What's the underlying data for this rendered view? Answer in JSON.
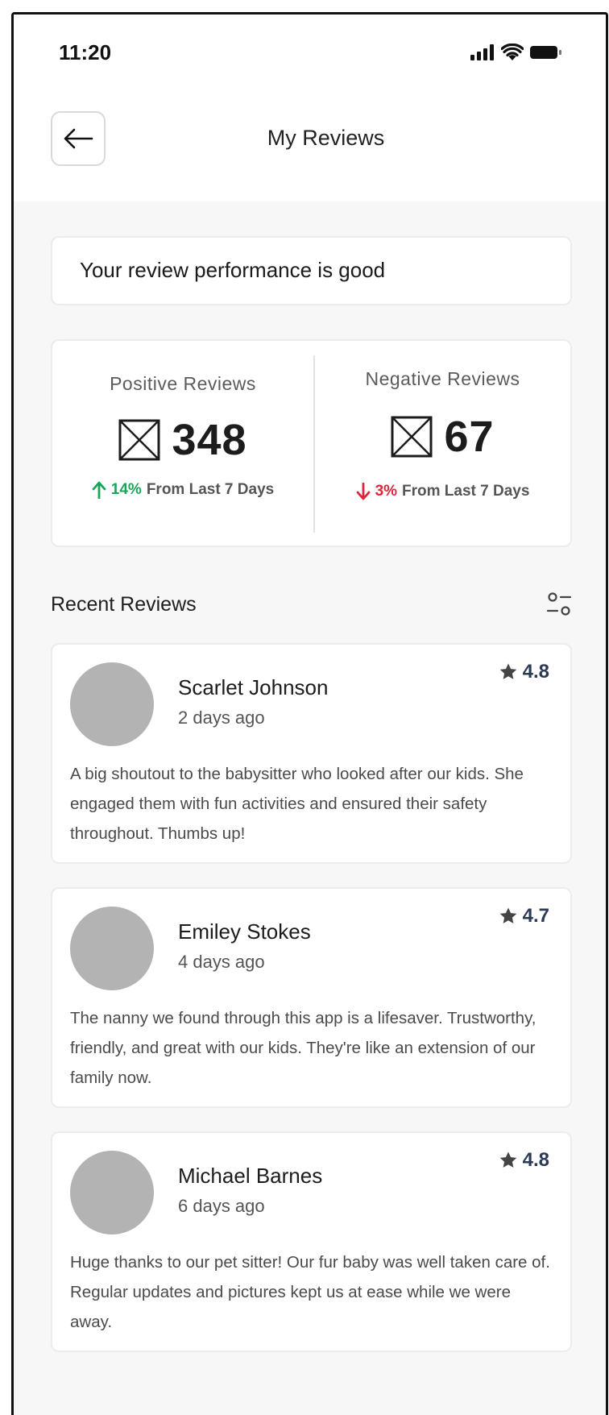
{
  "status_bar": {
    "time": "11:20"
  },
  "header": {
    "title": "My Reviews"
  },
  "performance": {
    "message": "Your review performance is good"
  },
  "stats": {
    "positive": {
      "label": "Positive Reviews",
      "value": "348",
      "change_pct": "14%",
      "change_text": "From Last 7 Days",
      "direction": "up",
      "color": "#1aa55a"
    },
    "negative": {
      "label": "Negative Reviews",
      "value": "67",
      "change_pct": "3%",
      "change_text": "From Last 7 Days",
      "direction": "down",
      "color": "#e0243a"
    }
  },
  "recent": {
    "title": "Recent Reviews",
    "reviews": [
      {
        "name": "Scarlet Johnson",
        "date": "2 days ago",
        "rating": "4.8",
        "text": "A big shoutout to the babysitter who looked after our kids. She engaged them with fun activities and ensured their safety throughout. Thumbs up!"
      },
      {
        "name": "Emiley Stokes",
        "date": "4 days ago",
        "rating": "4.7",
        "text": "The nanny we found through this app is a lifesaver. Trustworthy, friendly, and great with our kids. They're like an extension of our family now."
      },
      {
        "name": "Michael Barnes",
        "date": "6 days ago",
        "rating": "4.8",
        "text": "Huge thanks to our pet sitter! Our fur baby was well taken care of. Regular updates and pictures kept us at ease while we were away."
      }
    ]
  },
  "icons": [
    "signal-icon",
    "wifi-icon",
    "battery-icon",
    "back-arrow-icon",
    "image-placeholder-icon",
    "arrow-up-icon",
    "arrow-down-icon",
    "filter-icon",
    "star-icon"
  ]
}
